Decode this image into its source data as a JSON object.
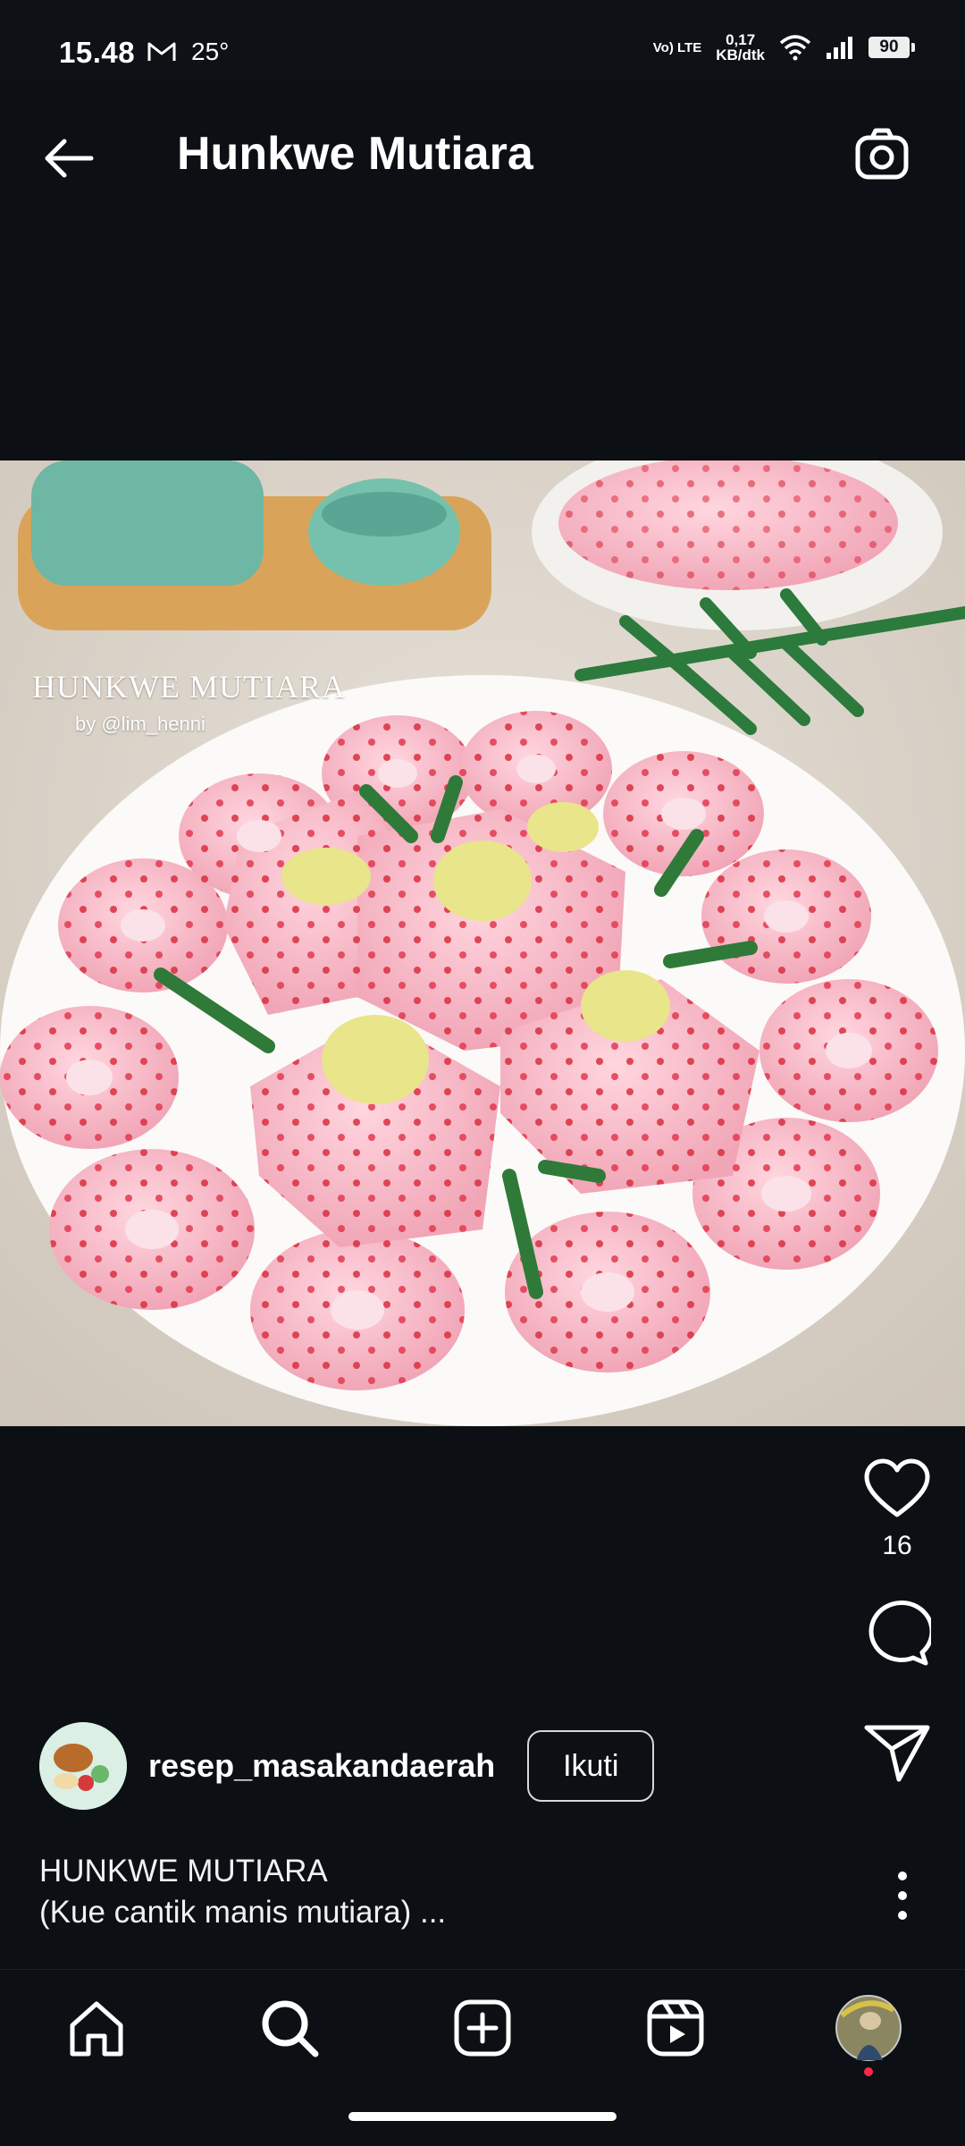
{
  "status_bar": {
    "time": "15.48",
    "gmail_icon": "gmail-icon",
    "temperature": "25°",
    "volte": "Vo) LTE",
    "speed_value": "0,17",
    "speed_unit": "KB/dtk",
    "battery": "90"
  },
  "header": {
    "title": "Hunkwe Mutiara",
    "back_icon": "arrow-left-icon",
    "camera_icon": "camera-icon"
  },
  "photo": {
    "overlay_title": "HUNKWE MUTIARA",
    "overlay_credit": "by @lim_henni"
  },
  "actions": {
    "likes": "16"
  },
  "author": {
    "username": "resep_masakandaerah",
    "follow_label": "Ikuti"
  },
  "caption": {
    "line1": "HUNKWE MUTIARA",
    "line2": "(Kue cantik manis mutiara) ..."
  },
  "nav": {
    "items": [
      "home-icon",
      "search-icon",
      "add-post-icon",
      "reels-icon",
      "profile-avatar"
    ]
  },
  "colors": {
    "background": "#0c0f14",
    "text": "#ffffff",
    "notification_dot": "#ff2a4b"
  }
}
